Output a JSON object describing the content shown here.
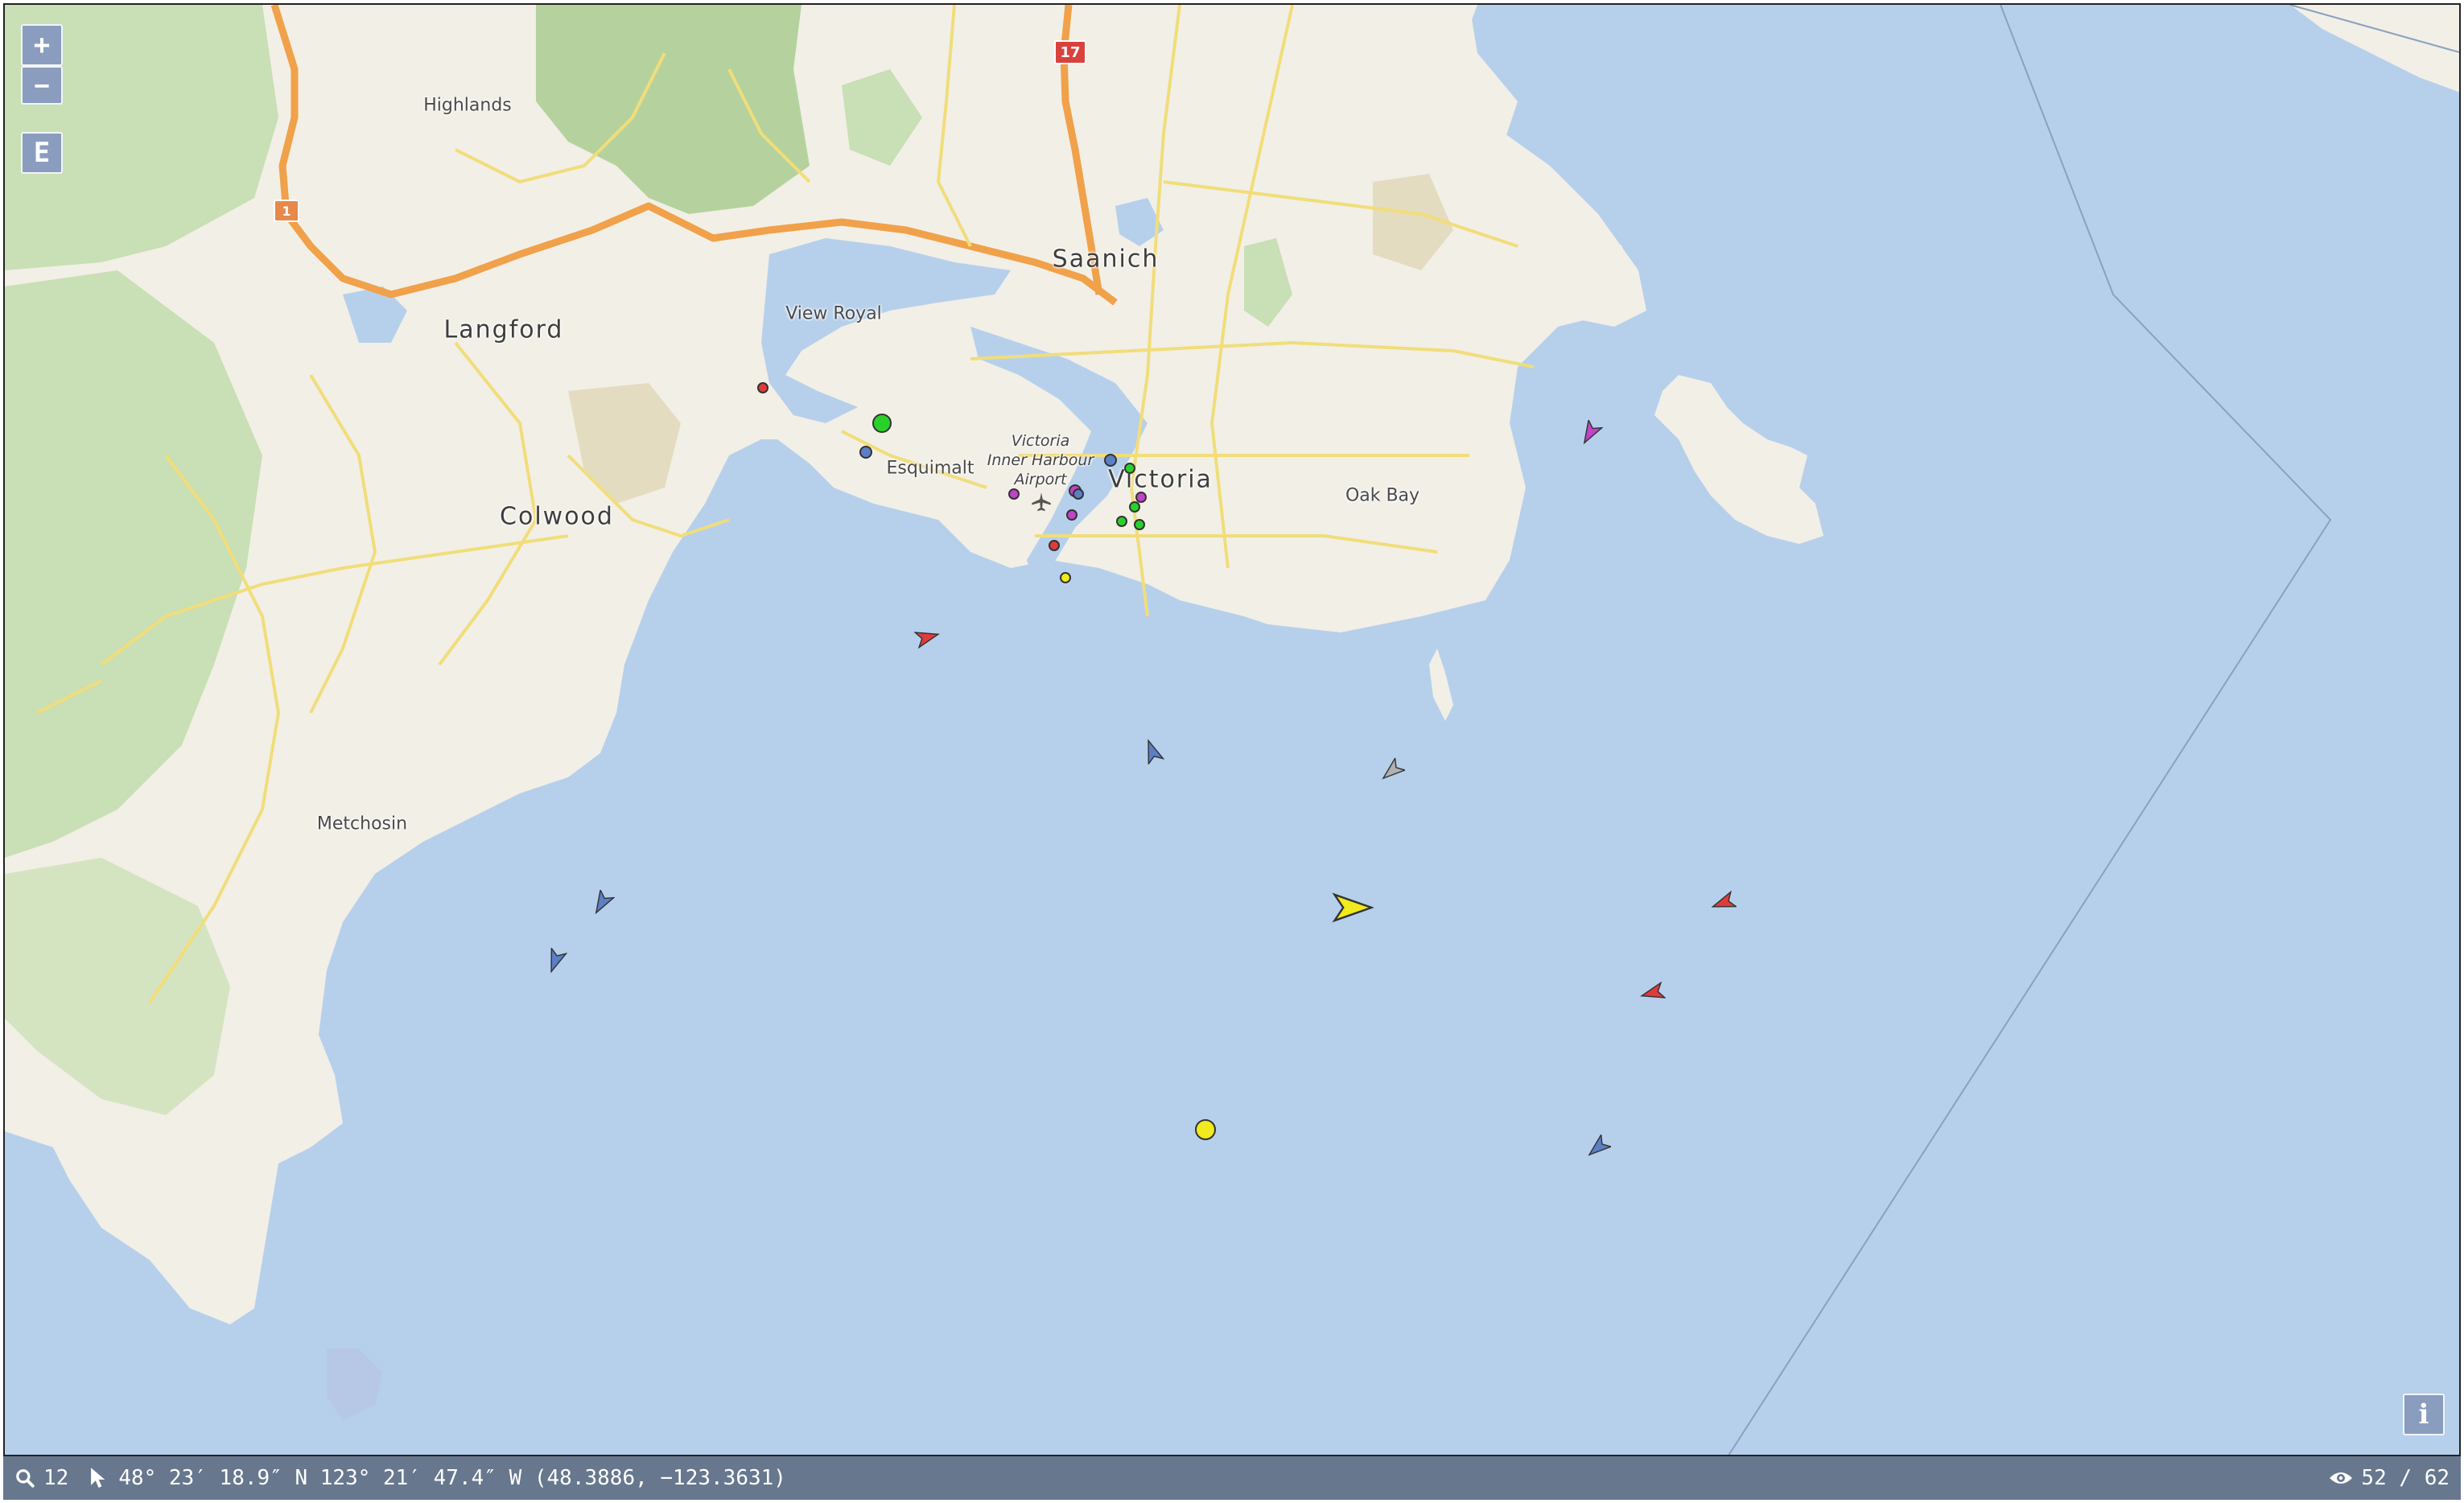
{
  "map": {
    "places": [
      {
        "id": "highlands",
        "name": "Highlands",
        "size": "medium"
      },
      {
        "id": "langford",
        "name": "Langford",
        "size": "large"
      },
      {
        "id": "view-royal",
        "name": "View Royal",
        "size": "medium"
      },
      {
        "id": "saanich",
        "name": "Saanich",
        "size": "large"
      },
      {
        "id": "esquimalt",
        "name": "Esquimalt",
        "size": "medium"
      },
      {
        "id": "victoria",
        "name": "Victoria",
        "size": "large"
      },
      {
        "id": "oak-bay",
        "name": "Oak Bay",
        "size": "medium"
      },
      {
        "id": "colwood",
        "name": "Colwood",
        "size": "large"
      },
      {
        "id": "metchosin",
        "name": "Metchosin",
        "size": "medium"
      }
    ],
    "airport_label": [
      "Victoria",
      "Inner Harbour",
      "Airport"
    ],
    "highway_shields": [
      {
        "id": "hwy-17",
        "number": "17",
        "color": "#d9413d"
      },
      {
        "id": "hwy-1",
        "number": "1",
        "color": "#e6894a"
      }
    ],
    "colors": {
      "water": "#b6d0ec",
      "land": "#f2efe6",
      "park": "#c9dfb5",
      "forest": "#b5d29e",
      "road_major": "#f0a14a",
      "road_minor": "#f1dd7a"
    }
  },
  "controls": {
    "zoom_in": "+",
    "zoom_out": "−",
    "layer_toggle": "E",
    "info": "i"
  },
  "status": {
    "zoom_icon": "search-icon",
    "zoom_level": "12",
    "pointer_icon": "cursor-icon",
    "coordinates": "48° 23′ 18.9″ N 123° 21′ 47.4″ W (48.3886, −123.3631)",
    "visible_icon": "eye-icon",
    "vessel_count": "52 / 62"
  },
  "vessels": [
    {
      "id": "v1",
      "shape": "arrow",
      "color": "#e03b3b",
      "heading": 75
    },
    {
      "id": "v2",
      "shape": "arrow",
      "color": "#5b7fc4",
      "heading": 340
    },
    {
      "id": "v3",
      "shape": "arrow",
      "color": "#b0b0b0",
      "heading": 230
    },
    {
      "id": "v4",
      "shape": "arrow",
      "color": "#f0ea1e",
      "heading": 90
    },
    {
      "id": "v5",
      "shape": "arrow",
      "color": "#e03b3b",
      "heading": 250
    },
    {
      "id": "v6",
      "shape": "arrow",
      "color": "#e03b3b",
      "heading": 255
    },
    {
      "id": "v7",
      "shape": "arrow",
      "color": "#5b7fc4",
      "heading": 210
    },
    {
      "id": "v8",
      "shape": "arrow",
      "color": "#5b7fc4",
      "heading": 200
    },
    {
      "id": "v9",
      "shape": "arrow",
      "color": "#5b7fc4",
      "heading": 230
    },
    {
      "id": "v10",
      "shape": "arrow",
      "color": "#c043c8",
      "heading": 210
    },
    {
      "id": "v11",
      "shape": "dot",
      "color": "#f0ea1e"
    },
    {
      "id": "v12",
      "shape": "dot",
      "color": "#2ad12a"
    },
    {
      "id": "v13",
      "shape": "dot",
      "color": "#e03b3b"
    },
    {
      "id": "v14",
      "shape": "dot",
      "color": "#5b7fc4"
    },
    {
      "id": "v15",
      "shape": "dot",
      "color": "#e03b3b"
    },
    {
      "id": "v16",
      "shape": "dot",
      "color": "#f0ea1e"
    },
    {
      "id": "v17",
      "shape": "dot",
      "color": "#c043c8"
    },
    {
      "id": "v18",
      "shape": "dot",
      "color": "#2ad12a"
    },
    {
      "id": "v19",
      "shape": "dot",
      "color": "#c043c8"
    },
    {
      "id": "v20",
      "shape": "dot",
      "color": "#5b7fc4"
    },
    {
      "id": "v21",
      "shape": "dot",
      "color": "#2ad12a"
    },
    {
      "id": "v22",
      "shape": "dot",
      "color": "#c043c8"
    },
    {
      "id": "v23",
      "shape": "dot",
      "color": "#2ad12a"
    },
    {
      "id": "v24",
      "shape": "dot",
      "color": "#c043c8"
    },
    {
      "id": "v25",
      "shape": "dot",
      "color": "#2ad12a"
    },
    {
      "id": "v26",
      "shape": "dot",
      "color": "#5b7fc4"
    }
  ]
}
